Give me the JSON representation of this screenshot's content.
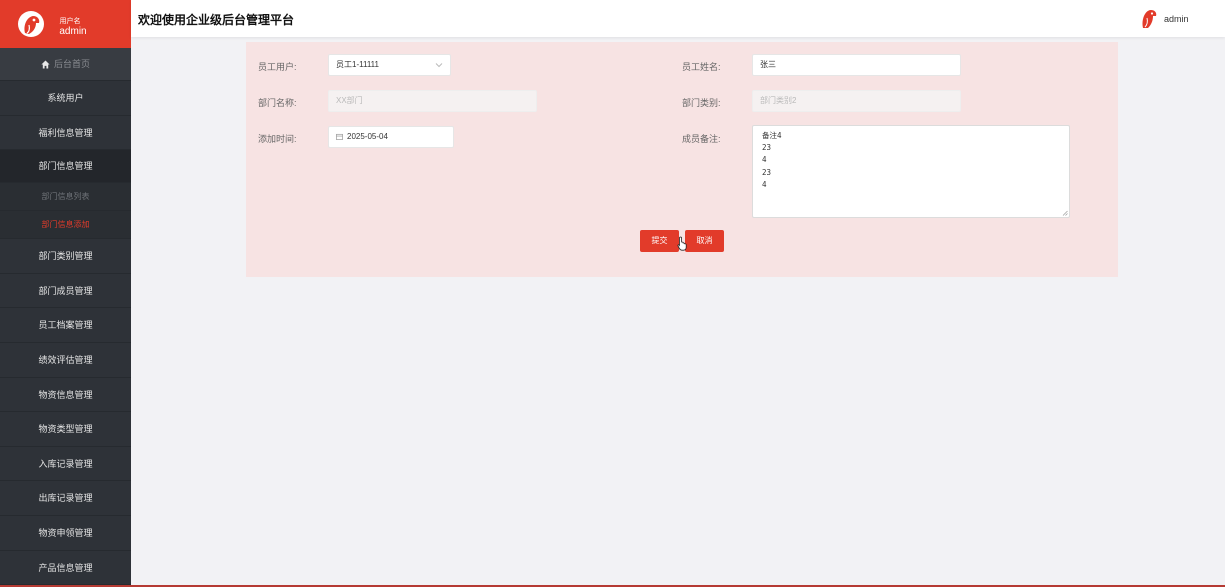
{
  "sidebar": {
    "user_label": "用户名",
    "username": "admin",
    "home": "后台首页",
    "items": [
      {
        "label": "系统用户"
      },
      {
        "label": "福利信息管理"
      }
    ],
    "active_group": "部门信息管理",
    "sub_items": [
      {
        "label": "部门信息列表"
      },
      {
        "label": "部门信息添加"
      }
    ],
    "more_items": [
      {
        "label": "部门类别管理"
      },
      {
        "label": "部门成员管理"
      },
      {
        "label": "员工档案管理"
      },
      {
        "label": "绩效评估管理"
      },
      {
        "label": "物资信息管理"
      },
      {
        "label": "物资类型管理"
      },
      {
        "label": "入库记录管理"
      },
      {
        "label": "出库记录管理"
      },
      {
        "label": "物资申领管理"
      },
      {
        "label": "产品信息管理"
      }
    ]
  },
  "header": {
    "title": "欢迎使用企业级后台管理平台",
    "user": "admin"
  },
  "form": {
    "employee_user_label": "员工用户:",
    "employee_user_value": "员工1-11111",
    "employee_name_label": "员工姓名:",
    "employee_name_value": "张三",
    "dept_name_label": "部门名称:",
    "dept_name_value": "XX部门",
    "dept_type_label": "部门类别:",
    "dept_type_value": "部门类别2",
    "add_time_label": "添加时间:",
    "add_time_value": "2025-05-04",
    "member_note_label": "成员备注:",
    "member_note_value": "备注4\n23\n4\n23\n4",
    "submit": "提交",
    "cancel": "取消"
  },
  "colors": {
    "brand": "#e23b2a",
    "sidebar_bg": "#2e3238",
    "panel_bg": "#f7e3e3"
  }
}
